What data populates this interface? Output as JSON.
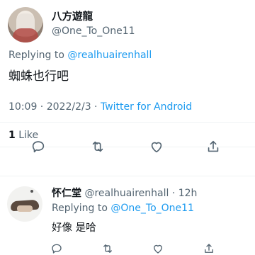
{
  "tweet": {
    "author_name": "八方遊龍",
    "author_handle": "@One_To_One11",
    "replying_prefix": "Replying to ",
    "replying_handle": "@realhuairenhall",
    "text": "蜘蛛也行吧",
    "time": "10:09",
    "sep1": " · ",
    "date": "2022/2/3",
    "sep2": " · ",
    "client": "Twitter for Android",
    "likes_count": "1",
    "likes_label": "Like"
  },
  "reply": {
    "author_name": "怀仁堂",
    "author_handle": "@realhuairenhall",
    "sep": " · ",
    "age": "12h",
    "replying_prefix": "Replying to ",
    "replying_handle": "@One_To_One11",
    "text": "好像 是哈"
  },
  "icons": {
    "reply": "reply-icon",
    "retweet": "retweet-icon",
    "like": "heart-icon",
    "share": "share-icon"
  },
  "colors": {
    "link": "#1d9bf0",
    "muted": "#536471",
    "text": "#0f1419"
  }
}
